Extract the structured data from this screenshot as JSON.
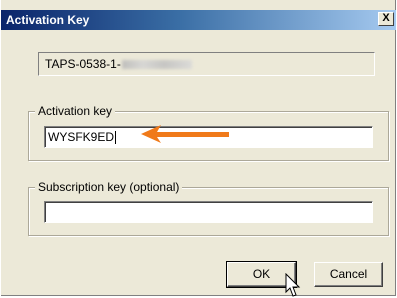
{
  "window": {
    "title": "Activation Key",
    "close_label": "X"
  },
  "product": {
    "id_visible": "TAPS-0538-1-"
  },
  "activation": {
    "group_label": "Activation key",
    "value": "WYSFK9ED"
  },
  "subscription": {
    "group_label": "Subscription key (optional)",
    "value": ""
  },
  "buttons": {
    "ok_label": "OK",
    "cancel_label": "Cancel"
  },
  "colors": {
    "arrow": "#f07a1a",
    "titlebar": "#0a246a"
  },
  "icons": {
    "pointer": "arrow-cursor-icon",
    "annotation": "orange-arrow-icon"
  }
}
